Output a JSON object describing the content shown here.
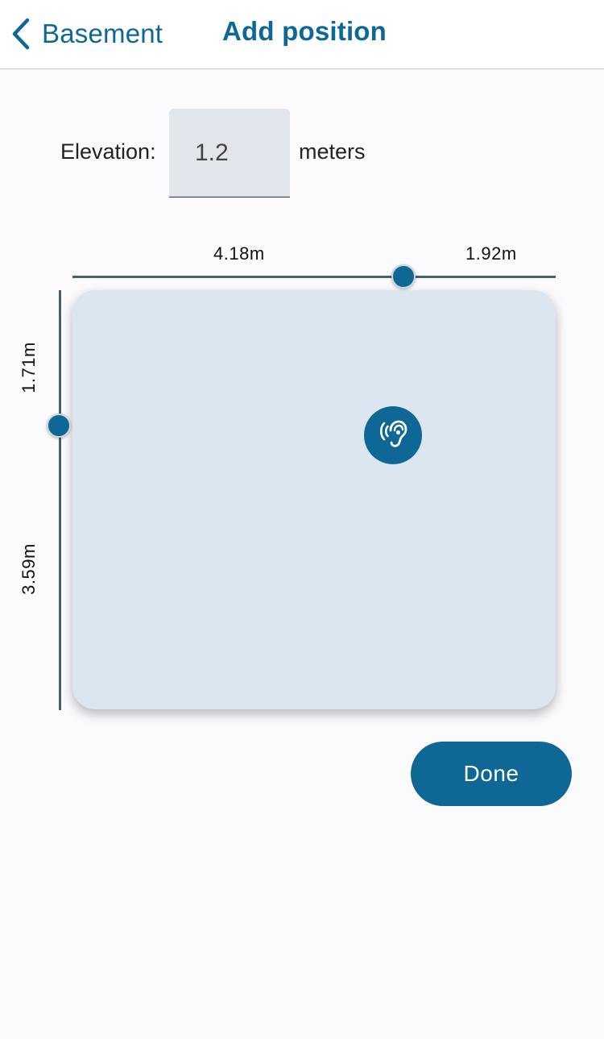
{
  "header": {
    "back_label": "Basement",
    "title": "Add position"
  },
  "elevation": {
    "label": "Elevation:",
    "value": "1.2",
    "unit": "meters"
  },
  "horizontal_ruler": {
    "left_distance": "4.18m",
    "right_distance": "1.92m"
  },
  "vertical_ruler": {
    "top_distance": "1.71m",
    "bottom_distance": "3.59m"
  },
  "position_marker": {
    "icon": "ear-icon"
  },
  "done_label": "Done",
  "colors": {
    "accent": "#0e6794",
    "room_fill": "#dbe6f1",
    "ruler": "#4d5f6c",
    "input_bg": "#e2e6ec",
    "page_bg": "#fbfbfd"
  }
}
